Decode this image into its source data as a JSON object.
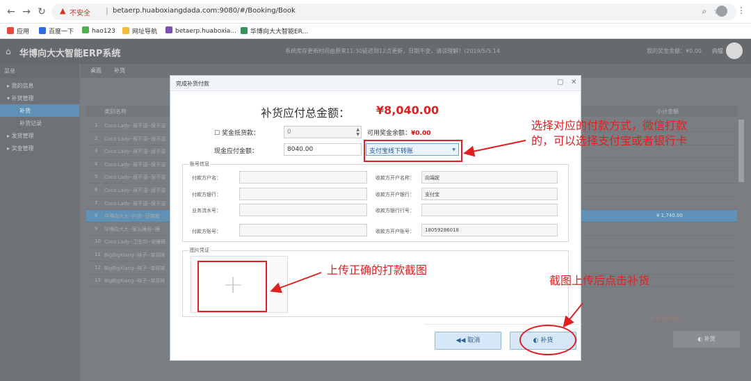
{
  "browser": {
    "security_label": "不安全",
    "url": "betaerp.huaboxiangdada.com:9080/#/Booking/Book",
    "bookmarks": [
      "应用",
      "百度一下",
      "hao123",
      "网址导航",
      "betaerp.huaboxia...",
      "华博向大大智能ER..."
    ]
  },
  "app": {
    "title": "华博向大大智能ERP系统",
    "notice": "系统库存更新时间由原来11:30延迟到12点更新，日期不变，请谅理解！(2019/5/5.14",
    "balance_label": "我的奖金余额：¥0.00",
    "user": "向锟"
  },
  "sidebar": {
    "header": "菜单",
    "items": [
      "我的信息",
      "补货管理",
      "补货",
      "补货记录",
      "发货管理",
      "奖金管理"
    ]
  },
  "tabs": [
    "桌面",
    "补货"
  ],
  "grid": {
    "headers": [
      "类别名称",
      "小计金额"
    ],
    "rows": [
      {
        "n": "1",
        "t": "Coco Lady--尿不湿--尿不湿"
      },
      {
        "n": "2",
        "t": "Coco Lady--尿不湿--尿不湿"
      },
      {
        "n": "3",
        "t": "Coco Lady--尿不湿--尿不湿"
      },
      {
        "n": "4",
        "t": "Coco Lady--尿不湿--尿不湿"
      },
      {
        "n": "5",
        "t": "Coco Lady--尿不湿--尿不湿"
      },
      {
        "n": "6",
        "t": "Coco Lady--尿不湿--尿不湿"
      },
      {
        "n": "7",
        "t": "Coco Lady--尿不湿--尿不湿"
      },
      {
        "n": "8",
        "t": "华博向大大--内衣--日韩款",
        "v": "¥ 1,740.00"
      },
      {
        "n": "9",
        "t": "华博向大大--家么睡用--睡"
      },
      {
        "n": "10",
        "t": "Coco Lady--卫生巾--安睡裤"
      },
      {
        "n": "11",
        "t": "BigBigXiang--袜子--单双袜"
      },
      {
        "n": "12",
        "t": "BigBigXiang--袜子--单双袜"
      },
      {
        "n": "13",
        "t": "BigBigXiang--袜子--单双袜"
      }
    ],
    "total": "¥ 8,040.00",
    "pay_button": "补货"
  },
  "modal": {
    "title": "完成补货付款",
    "heading": "补货应付总金额：",
    "amount": "¥8,040.00",
    "bonus_label": "奖金抵货款：",
    "bonus_value": "0",
    "available_label": "可用奖金余额：",
    "available_value": "¥0.00",
    "cash_label": "现金应付金额：",
    "cash_value": "8040.00",
    "payment_method": "支付宝线下转账",
    "account_legend": "账号信息",
    "payer_name_label": "付款方户名：",
    "payee_name_label": "收款方开户名称：",
    "payee_name": "向端妮",
    "payer_bank_label": "付款方银行：",
    "payee_bank_label": "收款方开户银行：",
    "payee_bank": "支付宝",
    "serial_label": "业务流水号：",
    "payee_bank_no_label": "收款方银行行号：",
    "payer_account_label": "付款方账号：",
    "payee_account_label": "收款方开户账号：",
    "payee_account": "18059286018",
    "image_legend": "图片凭证",
    "cancel": "取消",
    "submit": "补货"
  },
  "annotations": {
    "a1_line1": "选择对应的付款方式，微信打款",
    "a1_line2": "的，可以选择支付宝或者银行卡",
    "a2": "上传正确的打款截图",
    "a3": "截图上传后点击补货"
  }
}
